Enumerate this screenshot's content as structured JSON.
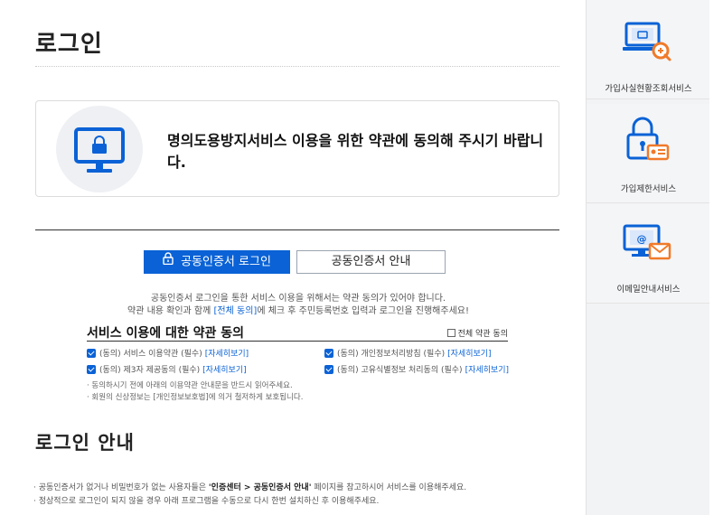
{
  "page": {
    "title": "로그인"
  },
  "notice": {
    "icon": "computer-lock-icon",
    "text": "명의도용방지서비스 이용을 위한 약관에 동의해 주시기 바랍니다."
  },
  "tabs": [
    {
      "label": "공동인증서 로그인",
      "active": true,
      "icon": "lock-icon"
    },
    {
      "label": "공동인증서 안내",
      "active": false
    }
  ],
  "description": {
    "line1": "공동인증서 로그인을 통한 서비스 이용을 위해서는 약관 동의가 있어야 합니다.",
    "line2_prefix": "약관 내용 확인과 함께 ",
    "line2_link": "[전체 동의]",
    "line2_suffix": "에 체크 후 주민등록번호 입력과 로그인을 진행해주세요!"
  },
  "terms": {
    "title": "서비스 이용에 대한 약관 동의",
    "all_agree_label": "전체 약관 동의",
    "items": [
      {
        "label": "(동의) 서비스 이용약관 (필수)",
        "link": "[자세히보기]",
        "checked": true
      },
      {
        "label": "(동의) 제3자 제공동의 (필수)",
        "link": "[자세히보기]",
        "checked": true
      },
      {
        "label": "(동의) 개인정보처리방침 (필수)",
        "link": "[자세히보기]",
        "checked": true
      },
      {
        "label": "(동의) 고유식별정보 처리동의 (필수)",
        "link": "[자세히보기]",
        "checked": true
      }
    ],
    "notes": [
      "· 동의하시기 전에 아래의 이용약관 안내문을 반드시 읽어주세요.",
      "· 회원의 신상정보는 [개인정보보호법]에 의거 철저하게 보호됩니다."
    ]
  },
  "guide": {
    "title": "로그인 안내",
    "line1_prefix": "· 공동인증서가 없거나 비밀번호가 없는 사용자들은 ",
    "line1_bold": "'인증센터 > 공동인증서 안내'",
    "line1_suffix": " 페이지를 참고하시어 서비스를 이용해주세요.",
    "line2": "· 정상적으로 로그인이 되지 않을 경우 아래 프로그램을 수동으로 다시 한번 설치하신 후 이용해주세요."
  },
  "sidebar": {
    "items": [
      {
        "label": "가입사실현황조회서비스",
        "icon": "laptop-search-icon"
      },
      {
        "label": "가입제한서비스",
        "icon": "lock-id-card-icon"
      },
      {
        "label": "이메일안내서비스",
        "icon": "monitor-email-icon"
      }
    ]
  },
  "colors": {
    "accent": "#0a62d6",
    "icon_orange": "#f07a2a",
    "sidebar_bg": "#f2f3f5"
  }
}
